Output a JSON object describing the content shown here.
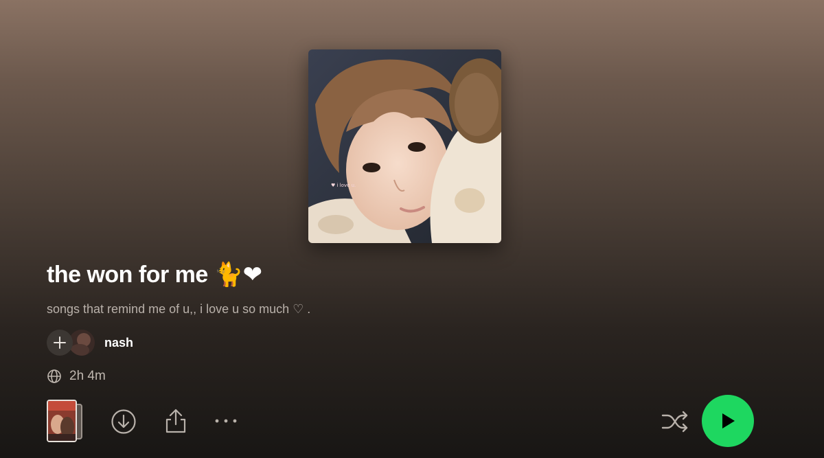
{
  "playlist": {
    "title": "the won for me 🐈❤",
    "description": "songs that remind me of u,, i love u so much ♡ .",
    "owner_name": "nash",
    "duration": "2h 4m",
    "cover_caption": "♥ i love u."
  },
  "icons": {
    "add": "plus-icon",
    "visibility": "globe-icon",
    "download": "download-circle-icon",
    "share": "share-icon",
    "more": "ellipsis-icon",
    "shuffle": "shuffle-icon",
    "play": "play-icon"
  },
  "colors": {
    "accent": "#1ed760",
    "text_secondary": "#b9b1aa"
  }
}
